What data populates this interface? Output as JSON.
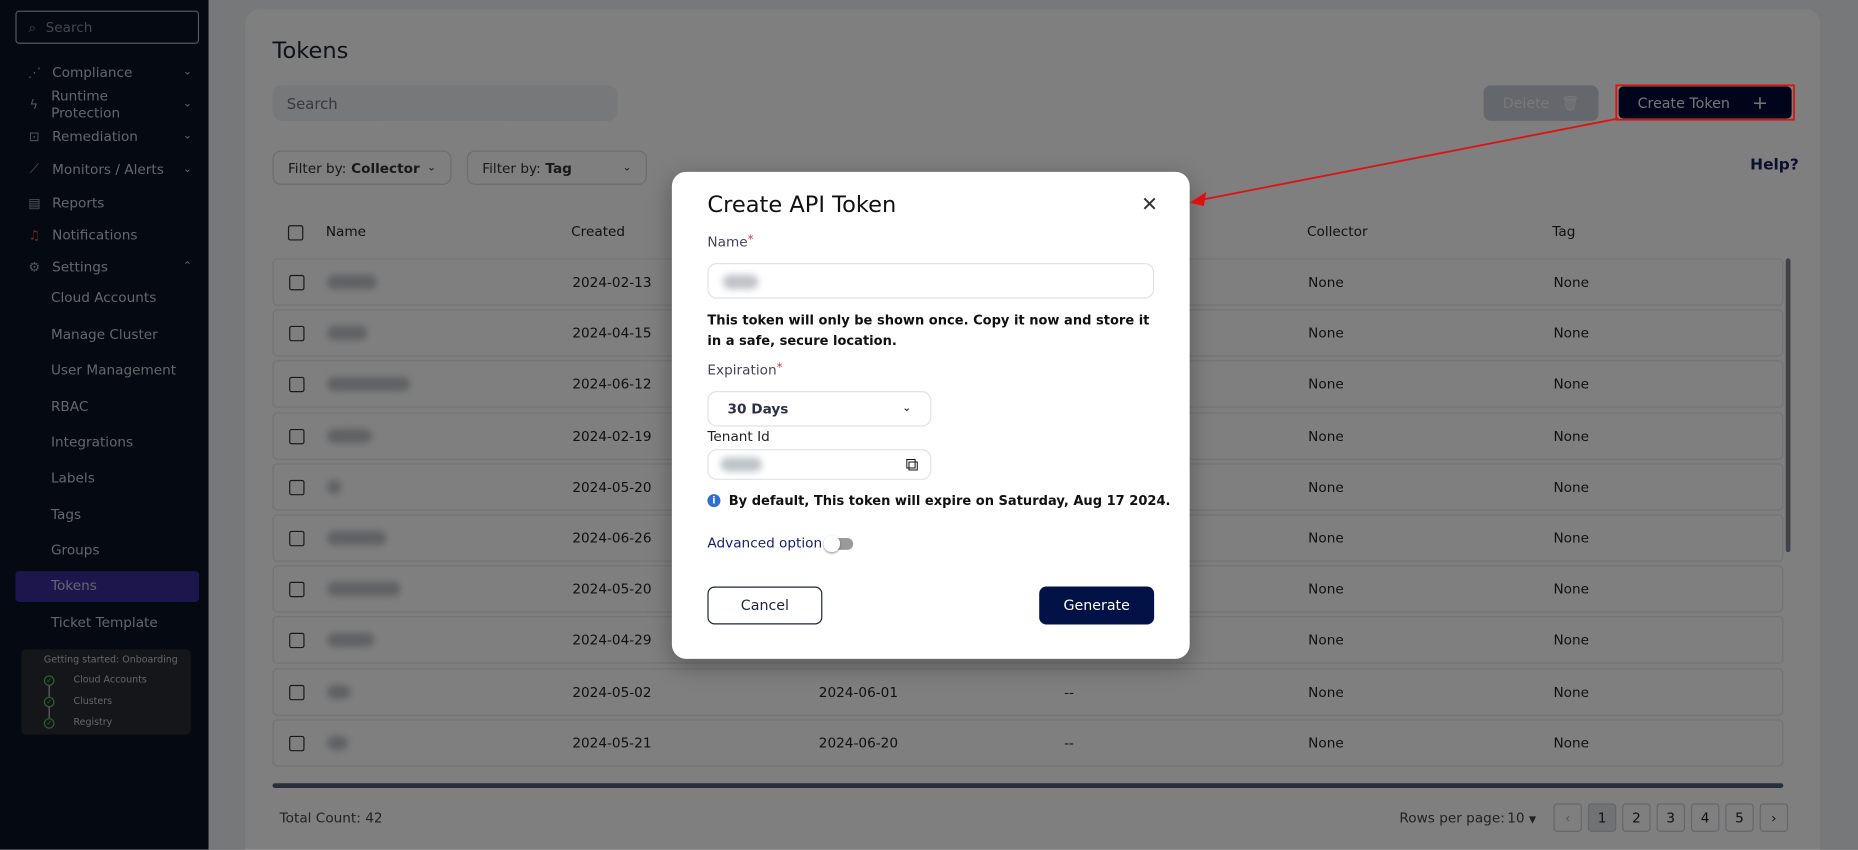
{
  "sidebar": {
    "search_placeholder": "Search",
    "items": [
      {
        "label": "Compliance",
        "icon": "chart-icon",
        "expanded": false
      },
      {
        "label": "Runtime Protection",
        "icon": "bolt-icon",
        "expanded": false
      },
      {
        "label": "Remediation",
        "icon": "lock-icon",
        "expanded": false
      },
      {
        "label": "Monitors / Alerts",
        "icon": "line-chart-icon",
        "expanded": false
      },
      {
        "label": "Reports",
        "icon": "clipboard-icon"
      },
      {
        "label": "Notifications",
        "icon": "bell-icon"
      },
      {
        "label": "Settings",
        "icon": "gear-icon",
        "expanded": true
      }
    ],
    "settings_items": [
      "Cloud Accounts",
      "Manage Cluster",
      "User Management",
      "RBAC",
      "Integrations",
      "Labels",
      "Tags",
      "Groups",
      "Tokens",
      "Ticket Template"
    ],
    "active_item": "Tokens",
    "onboarding": {
      "title": "Getting started: Onboarding",
      "steps": [
        "Cloud Accounts",
        "Clusters",
        "Registry"
      ]
    }
  },
  "page": {
    "title": "Tokens",
    "search_placeholder": "Search",
    "delete_label": "Delete",
    "create_label": "Create Token",
    "filter_prefix": "Filter by:",
    "filter_collector": "Collector",
    "filter_tag": "Tag",
    "help": "Help?"
  },
  "table": {
    "headers": [
      "Name",
      "Created",
      "",
      "",
      "Collector",
      "Tag"
    ],
    "rows": [
      {
        "created": "2024-02-13",
        "expires": "",
        "col4": "",
        "collector": "None",
        "tag": "None"
      },
      {
        "created": "2024-04-15",
        "expires": "",
        "col4": "",
        "collector": "None",
        "tag": "None"
      },
      {
        "created": "2024-06-12",
        "expires": "",
        "col4": "",
        "collector": "None",
        "tag": "None"
      },
      {
        "created": "2024-02-19",
        "expires": "",
        "col4": "",
        "collector": "None",
        "tag": "None"
      },
      {
        "created": "2024-05-20",
        "expires": "",
        "col4": "",
        "collector": "None",
        "tag": "None"
      },
      {
        "created": "2024-06-26",
        "expires": "",
        "col4": "",
        "collector": "None",
        "tag": "None"
      },
      {
        "created": "2024-05-20",
        "expires": "",
        "col4": "",
        "collector": "None",
        "tag": "None"
      },
      {
        "created": "2024-04-29",
        "expires": "",
        "col4": "",
        "collector": "None",
        "tag": "None"
      },
      {
        "created": "2024-05-02",
        "expires": "2024-06-01",
        "col4": "--",
        "collector": "None",
        "tag": "None"
      },
      {
        "created": "2024-05-21",
        "expires": "2024-06-20",
        "col4": "--",
        "collector": "None",
        "tag": "None"
      }
    ]
  },
  "footer": {
    "total": "Total Count: 42",
    "rows_per_page_label": "Rows per page:",
    "rows_per_page": "10",
    "pages": [
      "1",
      "2",
      "3",
      "4",
      "5"
    ],
    "current_page": "1"
  },
  "modal": {
    "title": "Create API Token",
    "name_label": "Name",
    "warning": "This token will only be shown once. Copy it now and store it in a safe, secure location.",
    "expiration_label": "Expiration",
    "expiration_value": "30 Days",
    "tenant_label": "Tenant Id",
    "info": "By default, This token will expire on Saturday, Aug 17 2024.",
    "advanced_label": "Advanced option",
    "advanced_enabled": false,
    "cancel": "Cancel",
    "generate": "Generate",
    "required_mark": "*"
  },
  "colors": {
    "sidebar_bg": "#0b1222",
    "active": "#3a2c9a",
    "primary": "#021246",
    "annotation": "#e01010",
    "info": "#2f6fd6"
  }
}
